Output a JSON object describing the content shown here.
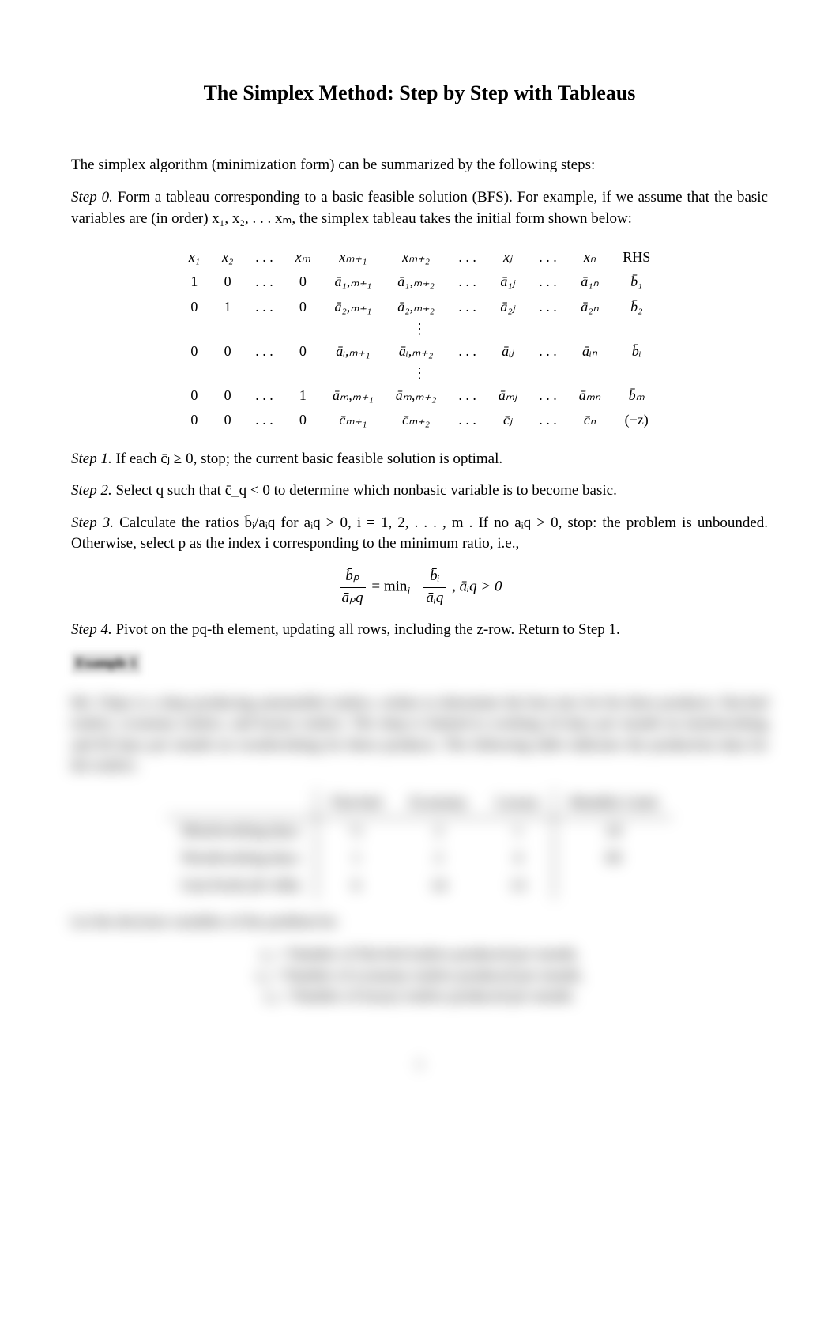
{
  "title": "The Simplex Method: Step by Step with Tableaus",
  "intro": "The simplex algorithm (minimization form) can be summarized by the following steps:",
  "step0": {
    "label": "Step 0.",
    "text": " Form a tableau corresponding to a basic feasible solution (BFS). For example, if we assume that the basic variables are (in order) x₁, x₂, . . . xₘ, the simplex tableau takes the initial form shown below:"
  },
  "tableau": {
    "header": [
      "x₁",
      "x₂",
      ". . .",
      "xₘ",
      "xₘ₊₁",
      "xₘ₊₂",
      ". . .",
      "xⱼ",
      ". . .",
      "xₙ",
      "RHS"
    ],
    "row1": [
      "1",
      "0",
      ". . .",
      "0",
      "ā₁,ₘ₊₁",
      "ā₁,ₘ₊₂",
      ". . .",
      "ā₁ⱼ",
      ". . .",
      "ā₁ₙ",
      "b̄₁"
    ],
    "row2": [
      "0",
      "1",
      ". . .",
      "0",
      "ā₂,ₘ₊₁",
      "ā₂,ₘ₊₂",
      ". . .",
      "ā₂ⱼ",
      ". . .",
      "ā₂ₙ",
      "b̄₂"
    ],
    "rowi": [
      "0",
      "0",
      ". . .",
      "0",
      "āᵢ,ₘ₊₁",
      "āᵢ,ₘ₊₂",
      ". . .",
      "āᵢⱼ",
      ". . .",
      "āᵢₙ",
      "b̄ᵢ"
    ],
    "rowm": [
      "0",
      "0",
      ". . .",
      "1",
      "āₘ,ₘ₊₁",
      "āₘ,ₘ₊₂",
      ". . .",
      "āₘⱼ",
      ". . .",
      "āₘₙ",
      "b̄ₘ"
    ],
    "rowc": [
      "0",
      "0",
      ". . .",
      "0",
      "c̄ₘ₊₁",
      "c̄ₘ₊₂",
      ". . .",
      "c̄ⱼ",
      ". . .",
      "c̄ₙ",
      "(−z)"
    ]
  },
  "step1": {
    "label": "Step 1.",
    "text": " If each c̄ⱼ ≥ 0, stop; the current basic feasible solution is optimal."
  },
  "step2": {
    "label": "Step 2.",
    "text": " Select q such that c̄_q < 0 to determine which nonbasic variable is to become basic."
  },
  "step3": {
    "label": "Step 3.",
    "text_a": " Calculate the ratios b̄ᵢ/āᵢq for āᵢq > 0, i = 1, 2, . . . , m . If no āᵢq > 0, stop: the problem is unbounded. Otherwise, select p as the index i corresponding to the minimum ratio, i.e.,"
  },
  "formula": {
    "lhs_num": "b̄ₚ",
    "lhs_den": "āₚq",
    "eq": " = min",
    "sub": "i",
    "rhs_num": "b̄ᵢ",
    "rhs_den": "āᵢq",
    "cond": ", āᵢq > 0"
  },
  "step4": {
    "label": "Step 4.",
    "text": " Pivot on the pq-th element, updating all rows, including the z-row. Return to Step 1."
  },
  "example": {
    "header": "Example 1",
    "para": "Mr. Chips is a shop producing automobile trailers, wishes to determine the best mix for his three products: flat-bed trailers, economy trailers, and luxury trailers. The shop is limited to working 24 days per month on metalworking and 60 days per month on woodworking for these products. The following table indicates the production data for the trailers.",
    "table": {
      "headers": [
        "",
        "Flat-bed",
        "Economy",
        "Luxury",
        "Monthly Limit"
      ],
      "rows": [
        [
          "Metalworking days:",
          "½",
          "2",
          "1",
          "24"
        ],
        [
          "Woodworking days:",
          "1",
          "2",
          "4",
          "60"
        ],
        [
          "Unit Profit ($×100):",
          "6",
          "14",
          "13",
          ""
        ]
      ]
    },
    "decisionvars": "Let the decision variables of the problem be:",
    "vars": [
      "x₁  =  Number of flat-bed trailers produced per month,",
      "x₂  =  Number of economy trailers produced per month,",
      "x₃  =  Number of luxury trailers produced per month."
    ]
  },
  "pagenum": "1"
}
